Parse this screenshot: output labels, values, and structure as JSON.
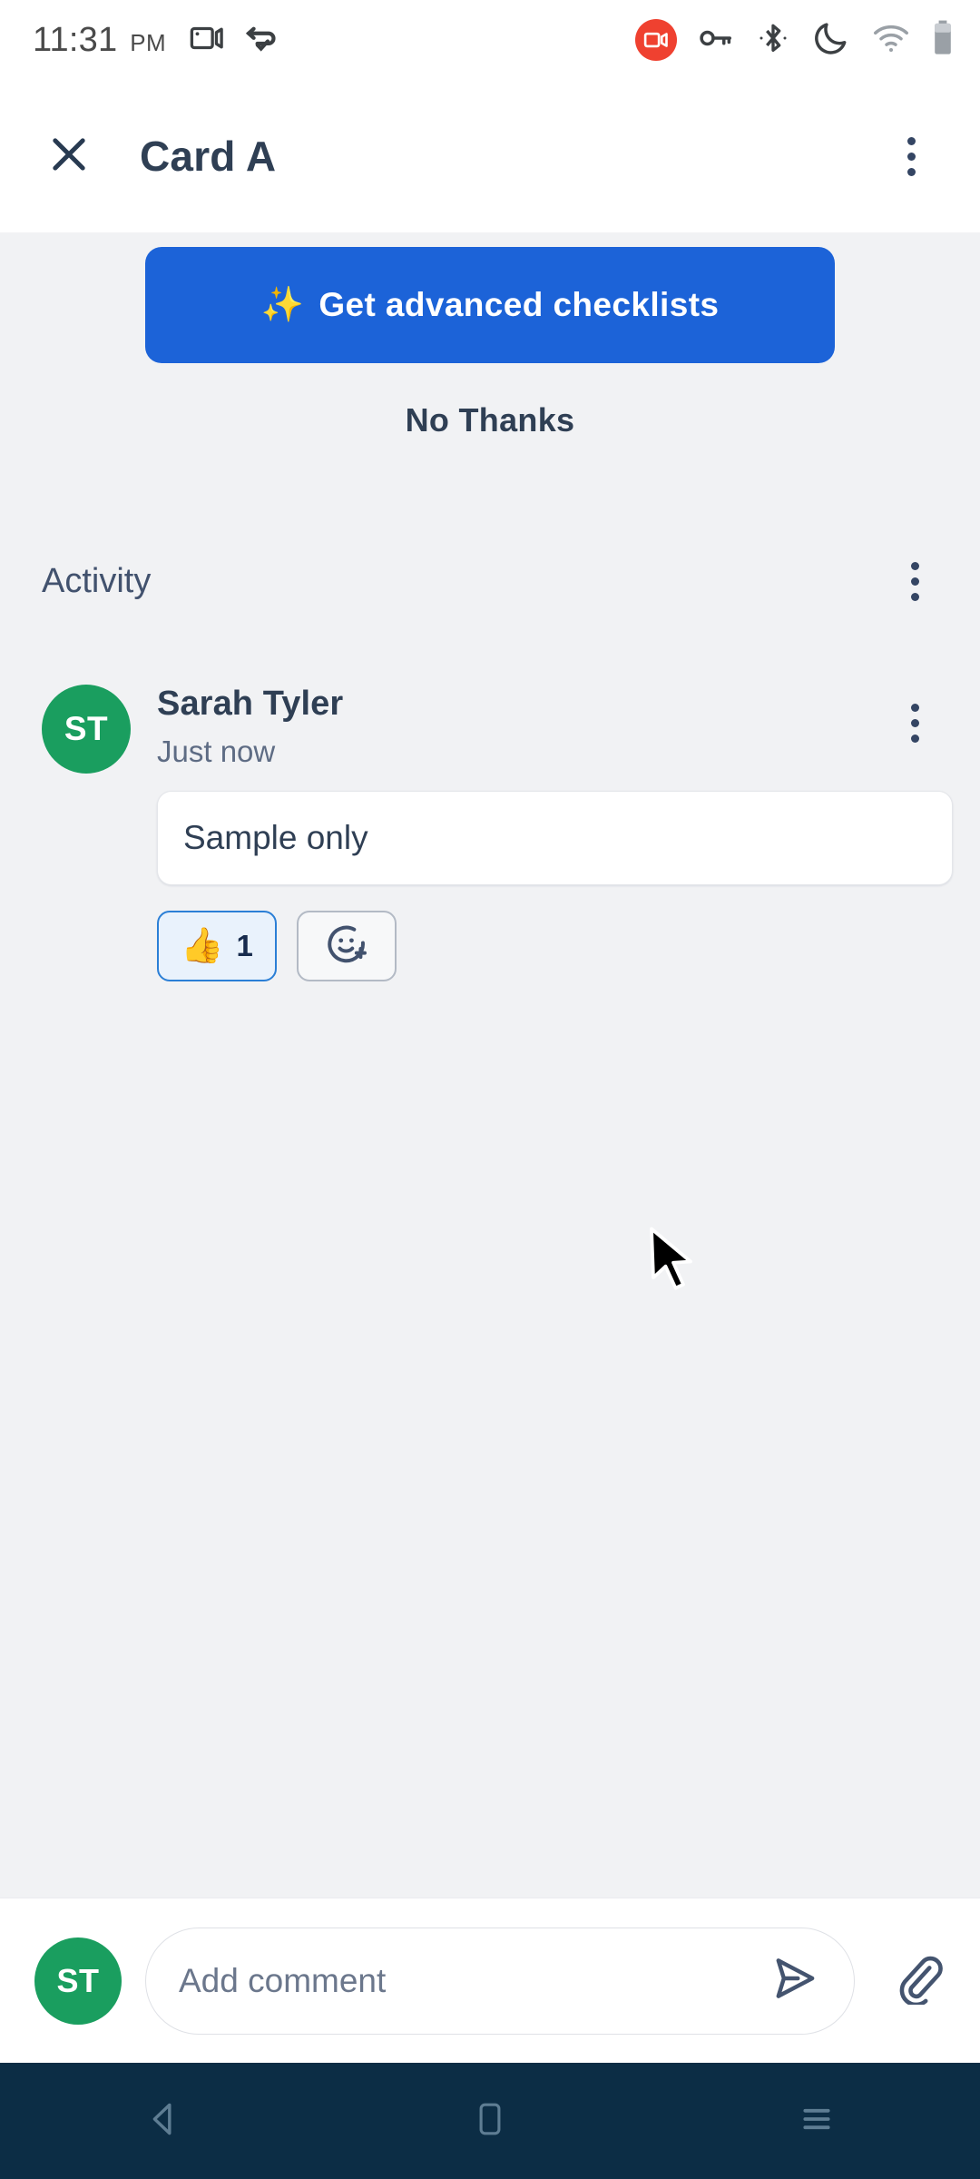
{
  "status_bar": {
    "time": "11:31",
    "ampm": "PM",
    "icons": [
      "screen-cast-icon",
      "app-sync-icon",
      "screen-recording-icon",
      "vpn-key-icon",
      "bluetooth-icon",
      "do-not-disturb-moon-icon",
      "wifi-icon",
      "battery-icon"
    ]
  },
  "app_bar": {
    "close_label": "Close",
    "title": "Card A",
    "overflow_label": "More options"
  },
  "promo": {
    "cta_sparkle": "✨",
    "cta_label": "Get advanced checklists",
    "dismiss_label": "No Thanks",
    "cta_color": "#1c63d8"
  },
  "activity": {
    "section_label": "Activity",
    "overflow_label": "Activity options",
    "comments": [
      {
        "avatar_initials": "ST",
        "avatar_color": "#1a9e5f",
        "author": "Sarah Tyler",
        "timestamp": "Just now",
        "body": "Sample only",
        "reactions": [
          {
            "emoji": "👍",
            "count": "1",
            "name": "thumbs-up-reaction"
          }
        ],
        "add_reaction_label": "Add reaction"
      }
    ]
  },
  "composer": {
    "avatar_initials": "ST",
    "avatar_color": "#1a9e5f",
    "placeholder": "Add comment",
    "value": "",
    "send_label": "Send",
    "attach_label": "Attach file"
  },
  "system_nav": {
    "back_label": "Back",
    "home_label": "Home",
    "recents_label": "Recent apps",
    "background": "#0c2d45"
  }
}
